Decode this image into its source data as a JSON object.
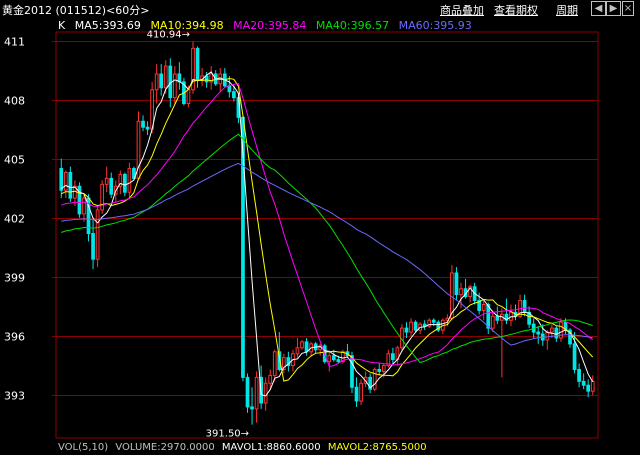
{
  "titlebar": {
    "symbol": "黄金2012 (011512)<60分>",
    "menu": [
      "商品叠加",
      "查看期权",
      "周期"
    ],
    "window_buttons": [
      "◀",
      "▶",
      "-",
      "▢",
      "×"
    ]
  },
  "legend": {
    "prefix": "K",
    "ma5": "MA5:393.69",
    "ma10": "MA10:394.98",
    "ma20": "MA20:395.84",
    "ma40": "MA40:396.57",
    "ma60": "MA60:395.93"
  },
  "volume_legend": {
    "vol": "VOL(5,10)",
    "volume": "VOLUME:2970.0000",
    "mavol1": "MAVOL1:8860.6000",
    "mavol2": "MAVOL2:8765.5000"
  },
  "colors": {
    "up": "#ff3232",
    "down": "#00e5e5",
    "grid": "#8b0000",
    "axis_text": "#ffffff",
    "ma5": "#ffffff",
    "ma10": "#ffff00",
    "ma20": "#ff00ff",
    "ma40": "#00e000",
    "ma60": "#6a6aff"
  },
  "chart_data": {
    "type": "candlestick",
    "y_ticks": [
      411,
      408,
      405,
      402,
      399,
      396,
      393
    ],
    "ylim": [
      391.0,
      411.8
    ],
    "annotations": [
      {
        "label": "410.94",
        "value": 410.94,
        "at": "high"
      },
      {
        "label": "391.50",
        "value": 391.5,
        "at": "low"
      }
    ],
    "candles": [
      [
        404.5,
        405.0,
        403.0,
        403.4
      ],
      [
        403.4,
        404.4,
        403.0,
        404.3
      ],
      [
        404.3,
        404.6,
        402.8,
        403.0
      ],
      [
        403.0,
        403.9,
        402.6,
        403.6
      ],
      [
        403.6,
        403.8,
        402.0,
        402.2
      ],
      [
        402.2,
        403.2,
        401.8,
        403.0
      ],
      [
        403.0,
        403.2,
        400.8,
        401.2
      ],
      [
        401.2,
        401.9,
        399.4,
        399.9
      ],
      [
        399.9,
        402.6,
        399.5,
        402.4
      ],
      [
        402.4,
        403.9,
        402.2,
        403.7
      ],
      [
        403.7,
        404.6,
        403.3,
        404.0
      ],
      [
        404.0,
        404.3,
        403.0,
        403.2
      ],
      [
        403.2,
        403.9,
        402.8,
        403.6
      ],
      [
        403.6,
        404.4,
        403.2,
        404.2
      ],
      [
        404.2,
        404.3,
        403.1,
        403.3
      ],
      [
        403.3,
        404.8,
        403.0,
        404.5
      ],
      [
        404.5,
        404.6,
        403.9,
        404.0
      ],
      [
        404.0,
        407.4,
        403.9,
        406.9
      ],
      [
        406.9,
        407.2,
        406.4,
        406.6
      ],
      [
        406.6,
        406.9,
        406.2,
        406.5
      ],
      [
        406.5,
        408.9,
        406.3,
        408.5
      ],
      [
        408.5,
        409.8,
        407.8,
        409.3
      ],
      [
        409.3,
        409.8,
        408.2,
        408.6
      ],
      [
        408.6,
        410.0,
        408.3,
        409.7
      ],
      [
        409.7,
        410.1,
        407.6,
        408.1
      ],
      [
        408.1,
        409.7,
        407.8,
        409.3
      ],
      [
        409.3,
        409.9,
        408.5,
        408.9
      ],
      [
        408.9,
        409.1,
        407.7,
        407.8
      ],
      [
        407.8,
        408.7,
        407.6,
        408.5
      ],
      [
        408.5,
        410.94,
        408.3,
        410.6
      ],
      [
        410.6,
        410.7,
        408.6,
        409.0
      ],
      [
        409.0,
        409.6,
        408.7,
        409.2
      ],
      [
        409.2,
        409.4,
        408.6,
        408.9
      ],
      [
        408.9,
        409.7,
        408.5,
        409.3
      ],
      [
        409.3,
        409.5,
        408.7,
        408.8
      ],
      [
        408.8,
        409.6,
        408.4,
        409.3
      ],
      [
        409.3,
        409.6,
        408.6,
        408.7
      ],
      [
        408.7,
        409.2,
        408.1,
        408.4
      ],
      [
        408.4,
        408.7,
        407.9,
        408.1
      ],
      [
        408.1,
        408.2,
        406.8,
        407.1
      ],
      [
        407.1,
        407.2,
        393.7,
        393.9
      ],
      [
        393.9,
        394.1,
        392.1,
        392.4
      ],
      [
        392.4,
        393.4,
        391.5,
        392.3
      ],
      [
        392.3,
        394.2,
        391.6,
        393.9
      ],
      [
        393.9,
        394.5,
        392.3,
        392.6
      ],
      [
        392.6,
        393.9,
        392.2,
        393.6
      ],
      [
        393.6,
        394.3,
        393.3,
        394.0
      ],
      [
        394.0,
        395.3,
        393.7,
        395.2
      ],
      [
        395.2,
        396.2,
        394.2,
        394.3
      ],
      [
        394.3,
        395.1,
        394.1,
        394.9
      ],
      [
        394.9,
        395.2,
        394.2,
        394.5
      ],
      [
        394.5,
        395.3,
        394.2,
        395.1
      ],
      [
        395.1,
        395.9,
        394.9,
        395.4
      ],
      [
        395.4,
        395.8,
        395.3,
        395.7
      ],
      [
        395.7,
        395.9,
        395.0,
        395.2
      ],
      [
        395.2,
        395.7,
        395.0,
        395.6
      ],
      [
        395.6,
        395.7,
        395.1,
        395.3
      ],
      [
        395.3,
        395.6,
        395.0,
        395.5
      ],
      [
        395.5,
        395.6,
        394.6,
        394.7
      ],
      [
        394.7,
        395.2,
        394.2,
        395.0
      ],
      [
        395.0,
        395.3,
        394.7,
        394.8
      ],
      [
        394.8,
        395.0,
        394.6,
        394.7
      ],
      [
        394.7,
        395.3,
        394.6,
        395.2
      ],
      [
        395.2,
        395.6,
        394.9,
        395.0
      ],
      [
        395.0,
        395.2,
        393.1,
        393.4
      ],
      [
        393.4,
        393.9,
        392.4,
        392.7
      ],
      [
        392.7,
        393.8,
        392.5,
        393.6
      ],
      [
        393.6,
        394.2,
        393.4,
        393.9
      ],
      [
        393.9,
        394.1,
        393.1,
        393.3
      ],
      [
        393.3,
        394.4,
        393.2,
        394.3
      ],
      [
        394.3,
        394.6,
        394.0,
        394.2
      ],
      [
        394.2,
        394.6,
        393.9,
        394.5
      ],
      [
        394.5,
        395.3,
        394.4,
        395.1
      ],
      [
        395.1,
        395.4,
        394.6,
        394.8
      ],
      [
        394.8,
        395.5,
        394.5,
        395.4
      ],
      [
        395.4,
        396.6,
        395.2,
        396.4
      ],
      [
        396.4,
        396.7,
        395.9,
        396.2
      ],
      [
        396.2,
        396.9,
        396.0,
        396.7
      ],
      [
        396.7,
        396.8,
        396.2,
        396.3
      ],
      [
        396.3,
        396.7,
        396.1,
        396.6
      ],
      [
        396.6,
        396.8,
        396.3,
        396.5
      ],
      [
        396.5,
        396.9,
        396.4,
        396.8
      ],
      [
        396.8,
        396.9,
        396.5,
        396.7
      ],
      [
        396.7,
        396.8,
        396.2,
        396.3
      ],
      [
        396.3,
        396.9,
        396.1,
        396.8
      ],
      [
        396.8,
        397.1,
        396.5,
        396.9
      ],
      [
        396.9,
        399.6,
        396.8,
        399.2
      ],
      [
        399.2,
        399.5,
        397.8,
        398.1
      ],
      [
        398.1,
        398.7,
        397.4,
        398.4
      ],
      [
        398.4,
        398.9,
        397.9,
        398.0
      ],
      [
        398.0,
        398.6,
        397.7,
        398.5
      ],
      [
        398.5,
        398.7,
        397.6,
        397.8
      ],
      [
        397.8,
        398.2,
        397.1,
        397.3
      ],
      [
        397.3,
        397.8,
        396.8,
        397.6
      ],
      [
        397.6,
        397.7,
        396.1,
        396.4
      ],
      [
        396.4,
        397.3,
        396.2,
        397.0
      ],
      [
        397.0,
        397.5,
        396.6,
        396.8
      ],
      [
        396.8,
        397.4,
        393.9,
        397.1
      ],
      [
        397.1,
        397.9,
        396.6,
        396.8
      ],
      [
        396.8,
        397.6,
        396.5,
        397.2
      ],
      [
        397.2,
        397.6,
        396.8,
        397.0
      ],
      [
        397.0,
        398.1,
        396.9,
        397.8
      ],
      [
        397.8,
        398.1,
        397.0,
        397.2
      ],
      [
        397.2,
        397.5,
        396.4,
        396.6
      ],
      [
        396.6,
        396.9,
        395.9,
        396.2
      ],
      [
        396.2,
        396.5,
        395.6,
        396.1
      ],
      [
        396.1,
        396.6,
        395.5,
        395.8
      ],
      [
        395.8,
        396.3,
        395.3,
        396.2
      ],
      [
        396.2,
        396.6,
        395.9,
        396.4
      ],
      [
        396.4,
        396.5,
        395.7,
        395.9
      ],
      [
        395.9,
        396.9,
        395.7,
        396.7
      ],
      [
        396.7,
        396.9,
        396.1,
        396.3
      ],
      [
        396.3,
        396.4,
        395.4,
        395.6
      ],
      [
        395.6,
        396.2,
        394.1,
        394.3
      ],
      [
        394.3,
        394.6,
        393.4,
        393.7
      ],
      [
        393.7,
        394.1,
        393.3,
        393.5
      ],
      [
        393.5,
        393.8,
        392.9,
        393.2
      ],
      [
        393.2,
        394.0,
        393.0,
        393.69
      ]
    ]
  }
}
